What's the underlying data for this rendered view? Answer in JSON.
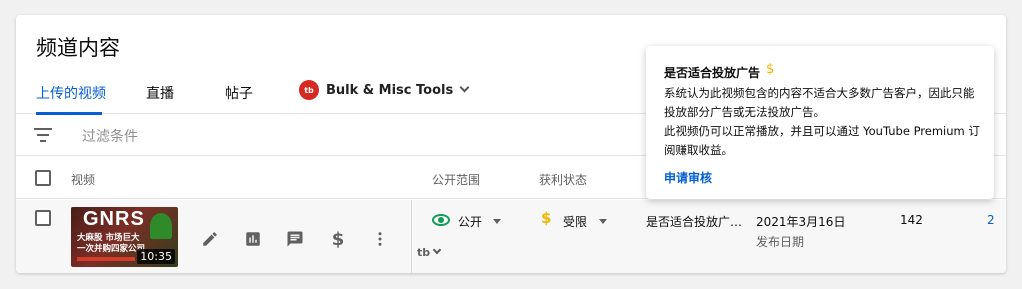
{
  "page": {
    "title": "频道内容"
  },
  "tabs": [
    {
      "label": "上传的视频"
    },
    {
      "label": "直播"
    },
    {
      "label": "帖子"
    }
  ],
  "tools_tab": {
    "logo_text": "tb",
    "label": "Bulk & Misc Tools"
  },
  "filter": {
    "placeholder": "过滤条件"
  },
  "columns": {
    "video": "视频",
    "visibility": "公开范围",
    "monetization": "获利状态"
  },
  "row": {
    "thumbnail": {
      "title": "GNRS",
      "subtitle_line1": "大麻股 市场巨大",
      "subtitle_line2": "一次并购四家公司",
      "duration": "10:35"
    },
    "tubebuddy_label": "tb",
    "visibility": "公开",
    "monetization": "受限",
    "restriction_reason": "是否适合投放广…",
    "date": "2021年3月16日",
    "date_label": "发布日期",
    "views": "142",
    "comments": "2"
  },
  "popup": {
    "title": "是否适合投放广告",
    "dollar_symbol": "$",
    "body_line1": "系统认为此视频包含的内容不适合大多数广告客户，因此只能投放部分广告或无法投放广告。",
    "body_line2": "此视频仍可以正常播放，并且可以通过 YouTube Premium 订阅赚取收益。",
    "link": "申请审核"
  },
  "colors": {
    "accent": "#065fd4",
    "visibility_green": "#0f9d58",
    "limited_gold": "#f2b600",
    "tubebuddy_red": "#d42a21"
  },
  "icons": {
    "filter": "filter-icon",
    "edit": "pencil-icon",
    "analytics": "bar-chart-icon",
    "comments": "comment-icon",
    "monetization": "dollar-icon",
    "more": "more-vert-icon",
    "visibility": "eye-icon"
  }
}
